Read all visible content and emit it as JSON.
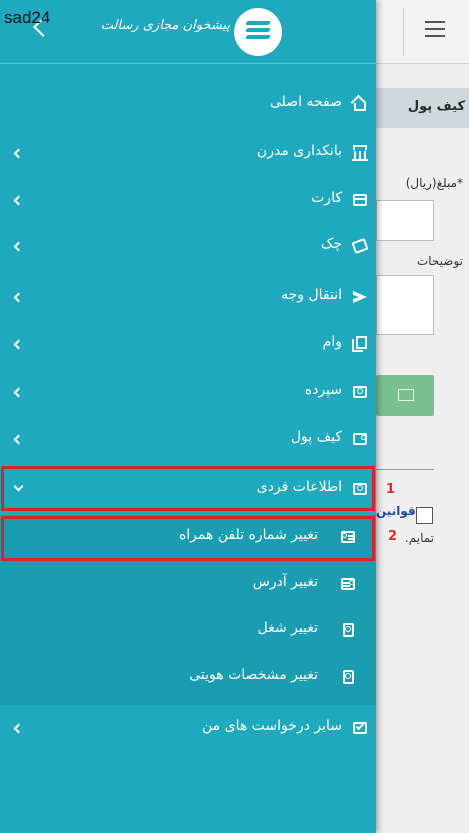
{
  "corner_tag": "sad24",
  "logo_text": "پیشخوان مجازی رسالت",
  "background_page": {
    "card_title": "کیف پول",
    "amount_label": "*مبلغ(ریال)",
    "description_label": "توضیحات",
    "terms_link": "قوانین",
    "terms_suffix": "تمایم."
  },
  "menu": {
    "items": [
      {
        "label": "صفحه اصلی",
        "icon": "home-icon",
        "has_chevron": false
      },
      {
        "label": "بانکداری مدرن",
        "icon": "bank-icon",
        "has_chevron": true
      },
      {
        "label": "کارت",
        "icon": "credit-card-icon",
        "has_chevron": true
      },
      {
        "label": "چک",
        "icon": "cheque-icon",
        "has_chevron": true
      },
      {
        "label": "انتقال وجه",
        "icon": "send-icon",
        "has_chevron": true
      },
      {
        "label": "وام",
        "icon": "loan-book-icon",
        "has_chevron": true
      },
      {
        "label": "سپرده",
        "icon": "deposit-icon",
        "has_chevron": true
      },
      {
        "label": "کیف پول",
        "icon": "wallet-icon",
        "has_chevron": true
      },
      {
        "label": "اطلاعات فردی",
        "icon": "personal-info-icon",
        "has_chevron": true,
        "expanded": true
      }
    ],
    "sub_items": [
      {
        "label": "تغییر شماره تلفن همراه",
        "icon": "id-card-icon"
      },
      {
        "label": "تغییر آدرس",
        "icon": "address-card-icon"
      },
      {
        "label": "تغییر شغل",
        "icon": "job-badge-icon"
      },
      {
        "label": "تغییر مشخصات هویتی",
        "icon": "identity-icon"
      }
    ],
    "last_item": {
      "label": "سایر درخواست های من",
      "icon": "checklist-icon"
    }
  },
  "annotations": {
    "box1_number": "1",
    "box2_number": "2"
  },
  "colors": {
    "drawer": "#1fa9be",
    "submenu": "#1a9db1",
    "highlight": "#d9232d"
  }
}
